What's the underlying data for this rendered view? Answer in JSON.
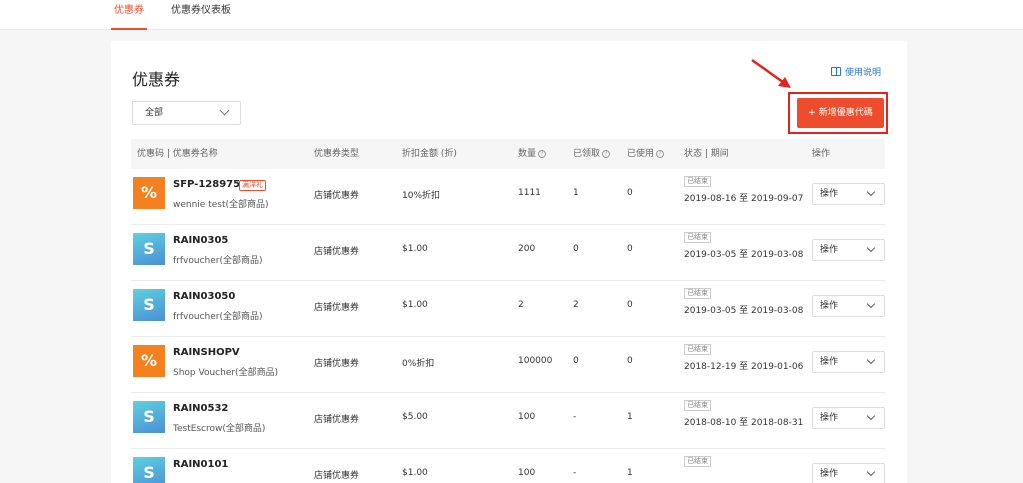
{
  "nav": {
    "tabs": [
      "优惠券",
      "优惠券仪表板"
    ]
  },
  "page": {
    "title": "优惠券",
    "guide_label": "使用说明",
    "filter_value": "全部",
    "add_button": "+ 新增優惠代碼"
  },
  "table": {
    "headers": [
      "优惠码 | 优惠券名称",
      "优惠券类型",
      "折扣金额 (折)",
      "数量",
      "已领取",
      "已使用",
      "状态 | 期间",
      "操作"
    ],
    "rows": [
      {
        "icon": "percent-icon",
        "code": "SFP-128975",
        "tag": "满洋礼",
        "desc": "wennie test(全部商品)",
        "type": "店铺优惠券",
        "discount": "10%折扣",
        "qty": "1111",
        "claimed": "1",
        "used": "0",
        "status": "已结束",
        "period": "2019-08-16 至 2019-09-07",
        "action": "操作"
      },
      {
        "icon": "dollar-icon",
        "code": "RAIN0305",
        "tag": "",
        "desc": "frfvoucher(全部商品)",
        "type": "店铺优惠券",
        "discount": "$1.00",
        "qty": "200",
        "claimed": "0",
        "used": "0",
        "status": "已结束",
        "period": "2019-03-05 至 2019-03-08",
        "action": "操作"
      },
      {
        "icon": "dollar-icon",
        "code": "RAIN03050",
        "tag": "",
        "desc": "frfvoucher(全部商品)",
        "type": "店铺优惠券",
        "discount": "$1.00",
        "qty": "2",
        "claimed": "2",
        "used": "0",
        "status": "已结束",
        "period": "2019-03-05 至 2019-03-08",
        "action": "操作"
      },
      {
        "icon": "percent-icon",
        "code": "RAINSHOPV",
        "tag": "",
        "desc": "Shop Voucher(全部商品)",
        "type": "店铺优惠券",
        "discount": "0%折扣",
        "qty": "100000",
        "claimed": "0",
        "used": "0",
        "status": "已结束",
        "period": "2018-12-19 至 2019-01-06",
        "action": "操作"
      },
      {
        "icon": "dollar-icon",
        "code": "RAIN0532",
        "tag": "",
        "desc": "TestEscrow(全部商品)",
        "type": "店铺优惠券",
        "discount": "$5.00",
        "qty": "100",
        "claimed": "-",
        "used": "1",
        "status": "已结束",
        "period": "2018-08-10 至 2018-08-31",
        "action": "操作"
      },
      {
        "icon": "dollar-icon",
        "code": "RAIN0101",
        "tag": "",
        "desc": "",
        "type": "店铺优惠券",
        "discount": "$1.00",
        "qty": "100",
        "claimed": "-",
        "used": "1",
        "status": "已结束",
        "period": "",
        "action": "操作"
      }
    ]
  },
  "colors": {
    "accent": "#ee4d2d",
    "link": "#2673dd",
    "highlight": "#e3231e"
  }
}
